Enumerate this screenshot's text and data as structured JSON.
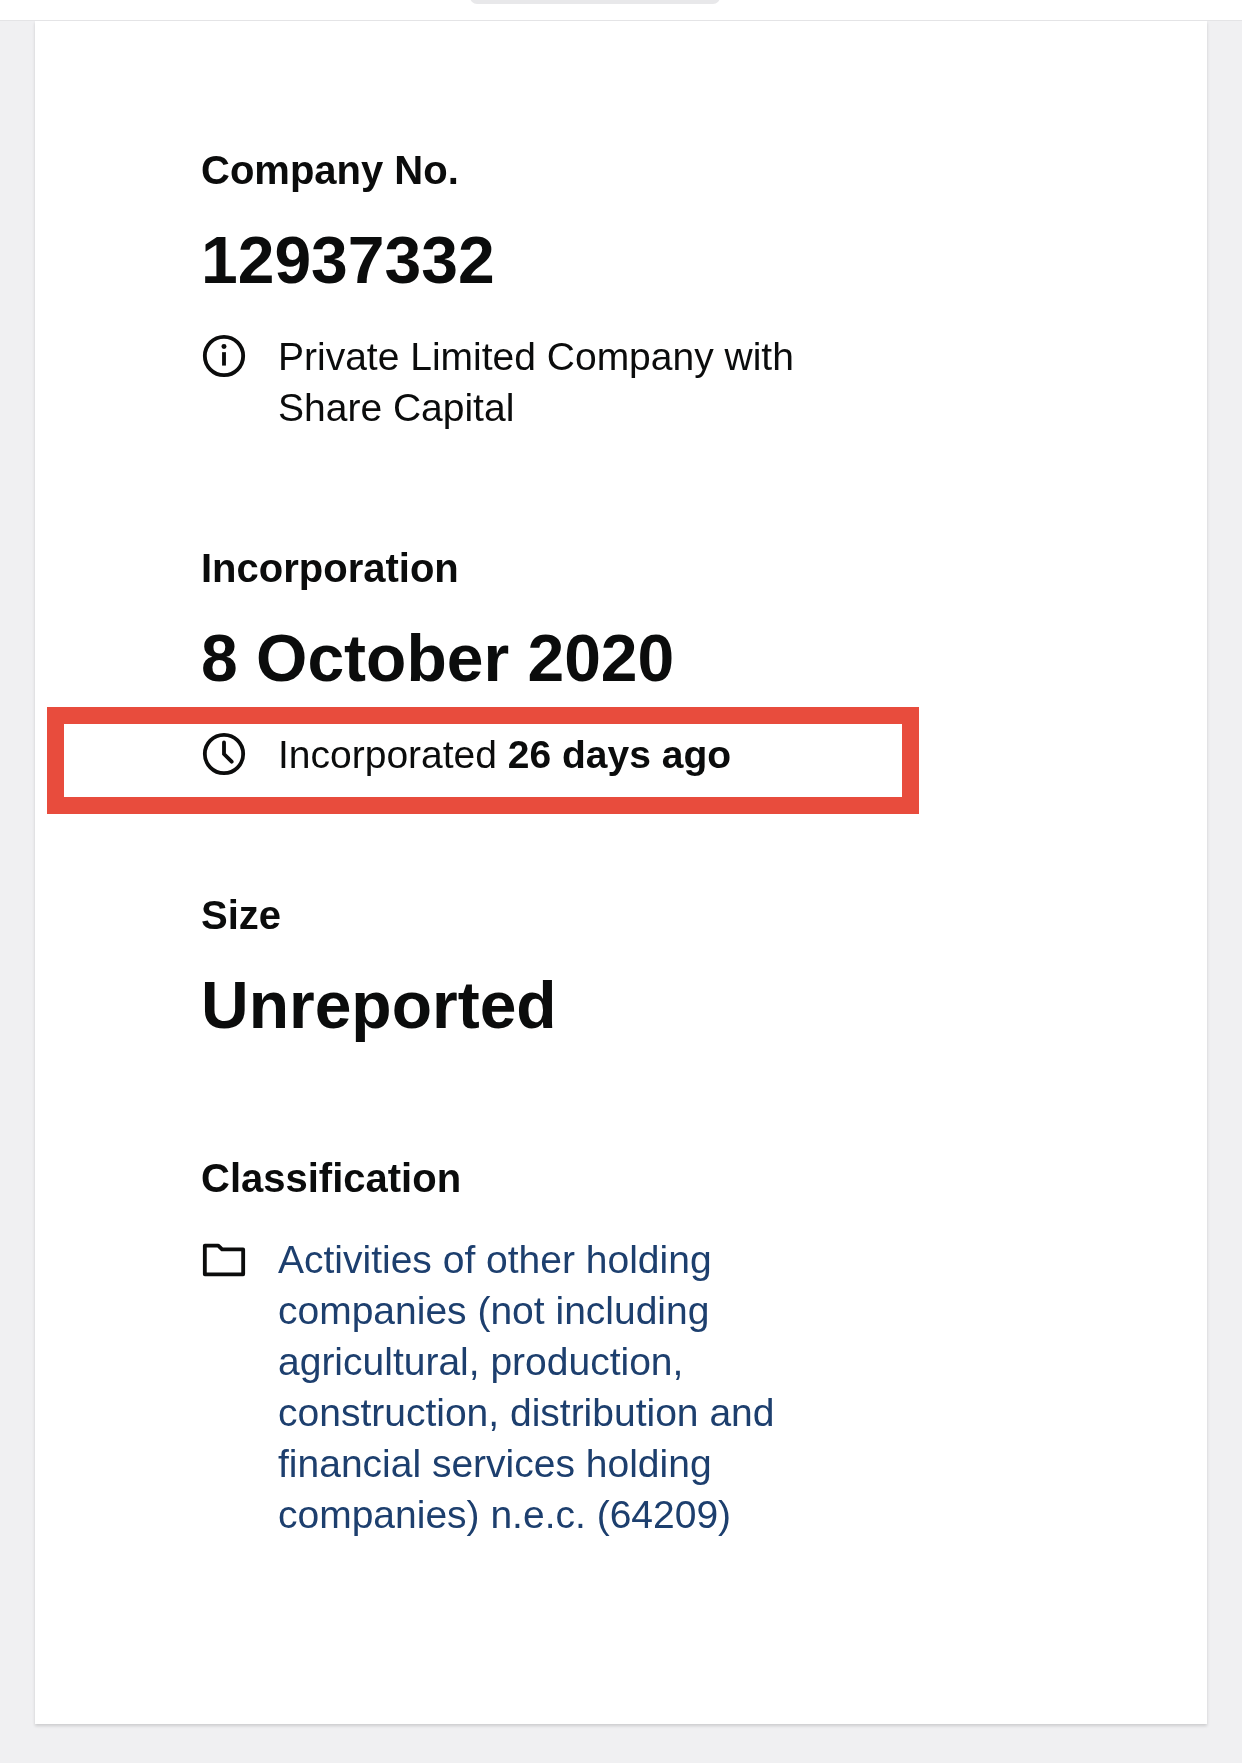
{
  "sections": [
    {
      "label": "Company No.",
      "value": "12937332",
      "note": {
        "kind": "info",
        "text": "Private Limited Company with Share Capital",
        "link": false,
        "highlighted": false
      }
    },
    {
      "label": "Incorporation",
      "value": "8 October 2020",
      "note": {
        "kind": "clock",
        "text": "Incorporated **26 days ago**",
        "link": false,
        "highlighted": true
      }
    },
    {
      "label": "Size",
      "value": "Unreported"
    },
    {
      "label": "Classification",
      "note": {
        "kind": "folder",
        "text": "Activities of other holding companies (not including agricultural, production, construction, distribution and financial services holding companies) n.e.c. (64209)",
        "link": true,
        "highlighted": false
      }
    }
  ]
}
